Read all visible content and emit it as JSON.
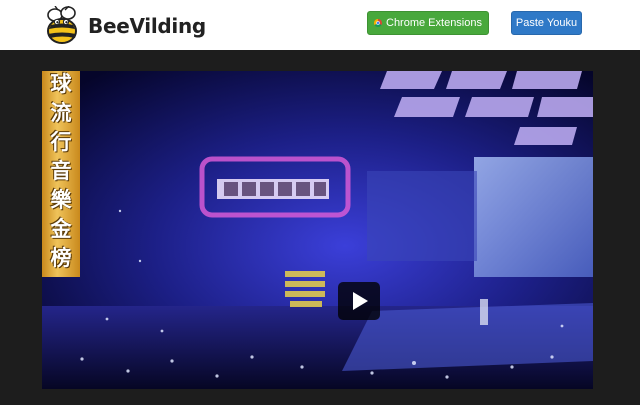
{
  "header": {
    "logo_text": "BeeVilding",
    "logo_icon": "bee-icon",
    "buttons": {
      "chrome_extensions": "Chrome Extensions",
      "paste_youku": "Paste Youku"
    }
  },
  "video": {
    "overlay_caption": "球流行音樂金榜",
    "play_icon": "play-icon"
  },
  "colors": {
    "chrome_button": "#48a83c",
    "youku_button": "#2f79c7",
    "page_background": "#1d1d1d"
  }
}
